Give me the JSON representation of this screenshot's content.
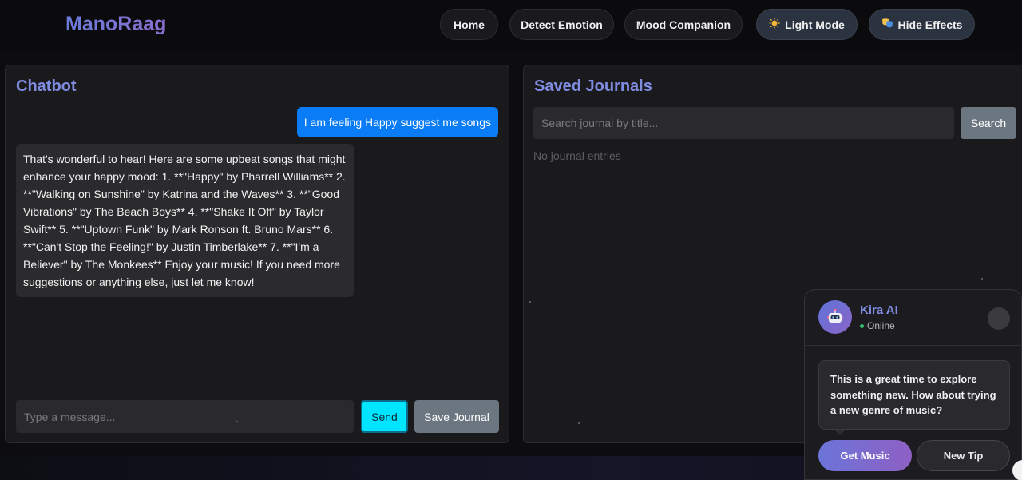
{
  "header": {
    "brand": "ManoRaag",
    "nav": [
      {
        "label": "Home"
      },
      {
        "label": "Detect Emotion"
      },
      {
        "label": "Mood Companion"
      }
    ],
    "light_mode": {
      "icon": "sun-icon",
      "label": "Light Mode"
    },
    "hide_effects": {
      "icon": "masks-icon",
      "label": "Hide Effects"
    }
  },
  "chatbot": {
    "title": "Chatbot",
    "messages": [
      {
        "role": "user",
        "text": "I am feeling Happy suggest me songs"
      },
      {
        "role": "bot",
        "text": "That's wonderful to hear! Here are some upbeat songs that might enhance your happy mood: 1. **\"Happy\" by Pharrell Williams** 2. **\"Walking on Sunshine\" by Katrina and the Waves** 3. **\"Good Vibrations\" by The Beach Boys** 4. **\"Shake It Off\" by Taylor Swift** 5. **\"Uptown Funk\" by Mark Ronson ft. Bruno Mars** 6. **\"Can't Stop the Feeling!\" by Justin Timberlake** 7. **\"I'm a Believer\" by The Monkees** Enjoy your music! If you need more suggestions or anything else, just let me know!"
      }
    ],
    "input_placeholder": "Type a message...",
    "send_label": "Send",
    "save_label": "Save Journal"
  },
  "journals": {
    "title": "Saved Journals",
    "search_placeholder": "Search journal by title...",
    "search_label": "Search",
    "empty_text": "No journal entries"
  },
  "kira": {
    "name": "Kira AI",
    "status": "Online",
    "message": "This is a great time to explore something new. How about trying a new genre of music?",
    "primary_label": "Get Music",
    "secondary_label": "New Tip"
  },
  "colors": {
    "accent": "#7f8ce0",
    "user_bubble": "#0a7cf5",
    "send_button": "#00e5ff",
    "secondary_button": "#6b7680"
  }
}
